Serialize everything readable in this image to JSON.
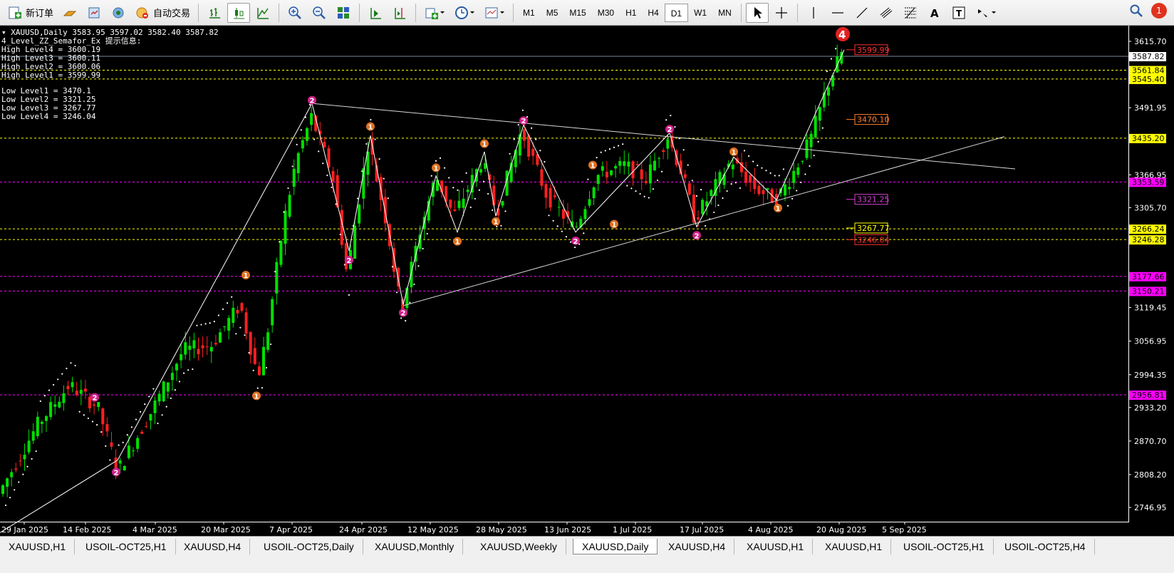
{
  "toolbar": {
    "new_order_label": "新订单",
    "auto_trading_label": "自动交易",
    "timeframes": [
      "M1",
      "M5",
      "M15",
      "M30",
      "H1",
      "H4",
      "D1",
      "W1",
      "MN"
    ],
    "active_timeframe": "D1",
    "notification_count": "1"
  },
  "chart": {
    "header": "XAUUSD,Daily  3583.95 3597.02 3582.40 3587.82",
    "indicator_name": "4_Level_ZZ_Semafor_Ex 提示信息:",
    "high_levels": [
      "High Level4 = 3600.19",
      "High Level3 = 3600.11",
      "High Level2 = 3600.06",
      "High Level1 = 3599.99"
    ],
    "low_levels": [
      "Low Level1 = 3470.1",
      "Low Level2 = 3321.25",
      "Low Level3 = 3267.77",
      "Low Level4 = 3246.04"
    ],
    "price_ticks": [
      "3615.70",
      "3491.95",
      "3366.95",
      "3305.70",
      "3119.45",
      "3056.95",
      "2994.35",
      "2933.20",
      "2870.70",
      "2808.20",
      "2746.95"
    ],
    "date_ticks": [
      "29 Jan 2025",
      "14 Feb 2025",
      "4 Mar 2025",
      "20 Mar 2025",
      "7 Apr 2025",
      "24 Apr 2025",
      "12 May 2025",
      "28 May 2025",
      "13 Jun 2025",
      "1 Jul 2025",
      "17 Jul 2025",
      "4 Aug 2025",
      "20 Aug 2025",
      "5 Sep 2025"
    ],
    "current_price": "3587.82",
    "horizontal_levels": [
      {
        "price": "3561.84",
        "color": "#ffff00",
        "style": "yellow"
      },
      {
        "price": "3545.40",
        "color": "#ffff00",
        "style": "yellow"
      },
      {
        "price": "3435.20",
        "color": "#ffff00",
        "style": "yellow"
      },
      {
        "price": "3353.59",
        "color": "#ff00ff",
        "style": "magenta"
      },
      {
        "price": "3266.24",
        "color": "#ffff00",
        "style": "yellow"
      },
      {
        "price": "3246.28",
        "color": "#ffff00",
        "style": "yellow"
      },
      {
        "price": "3177.66",
        "color": "#ff00ff",
        "style": "magenta"
      },
      {
        "price": "3150.21",
        "color": "#ff00ff",
        "style": "magenta"
      },
      {
        "price": "2956.81",
        "color": "#ff00ff",
        "style": "magenta"
      }
    ],
    "level_labels": [
      {
        "text": "3599.99",
        "color": "#ff3030"
      },
      {
        "text": "3470.10",
        "color": "#ff8030"
      },
      {
        "text": "3321.25",
        "color": "#d040d0"
      },
      {
        "text": "3267.77",
        "color": "#ffff00"
      },
      {
        "text": "3246.04",
        "color": "#ff3030"
      }
    ],
    "semafor_marks": [
      {
        "label": "2",
        "color": "#d0208a"
      },
      {
        "label": "1",
        "color": "#e07020"
      },
      {
        "label": "4",
        "color": "#e02020"
      }
    ]
  },
  "tabs": [
    "XAUUSD,H1",
    "USOIL-OCT25,H1",
    "XAUUSD,H4",
    "USOIL-OCT25,Daily",
    "XAUUSD,Monthly",
    "XAUUSD,Weekly",
    "XAUUSD,Daily",
    "XAUUSD,H4",
    "XAUUSD,H1",
    "XAUUSD,H1",
    "USOIL-OCT25,H1",
    "USOIL-OCT25,H4"
  ],
  "active_tab": "XAUUSD,Daily"
}
